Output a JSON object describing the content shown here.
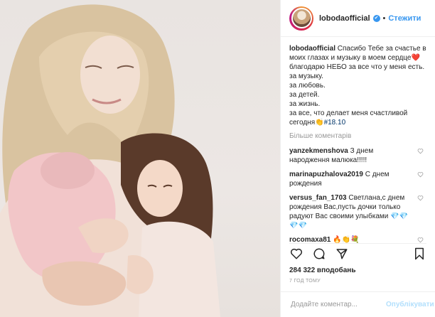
{
  "post": {
    "username": "lobodaofficial",
    "verified_mark": "✔",
    "separator": "•",
    "follow_label": "Стежити"
  },
  "caption": {
    "username": "lobodaofficial",
    "lines": [
      "Спасибо Тебе за счастье в",
      "моих глазах и музыку в моем сердце❤️",
      "благодарю НЕБО за все что у меня есть.",
      "за музыку.",
      "за любовь.",
      "за детей.",
      "за жизнь.",
      "за все, что делает меня счастливой",
      "сегодня👏"
    ],
    "hashtag": "#18.10"
  },
  "more_comments_label": "Більше коментарів",
  "comments": [
    {
      "username": "yanzekmenshova",
      "text": "З днем народження малюка!!!!!"
    },
    {
      "username": "marinapuzhalova2019",
      "text": "С днем рождения"
    },
    {
      "username": "versus_fan_1703",
      "text": "Светлана,с днем рождения Вас,пусть дочки только радуют Вас своими улыбками 💎💎💎💎"
    },
    {
      "username": "rocomaxa81",
      "text": "🔥👏💐"
    }
  ],
  "likes": "284 322 вподобань",
  "timestamp": "7 ГОД ТОМУ",
  "add_comment": {
    "placeholder": "Додайте коментар...",
    "submit_label": "Опублікувати"
  },
  "icons": {
    "like": "heart-icon",
    "comment": "comment-icon",
    "share": "share-icon",
    "save": "bookmark-icon"
  },
  "colors": {
    "link_blue": "#3897f0",
    "hashtag": "#003569",
    "muted": "#999999"
  }
}
